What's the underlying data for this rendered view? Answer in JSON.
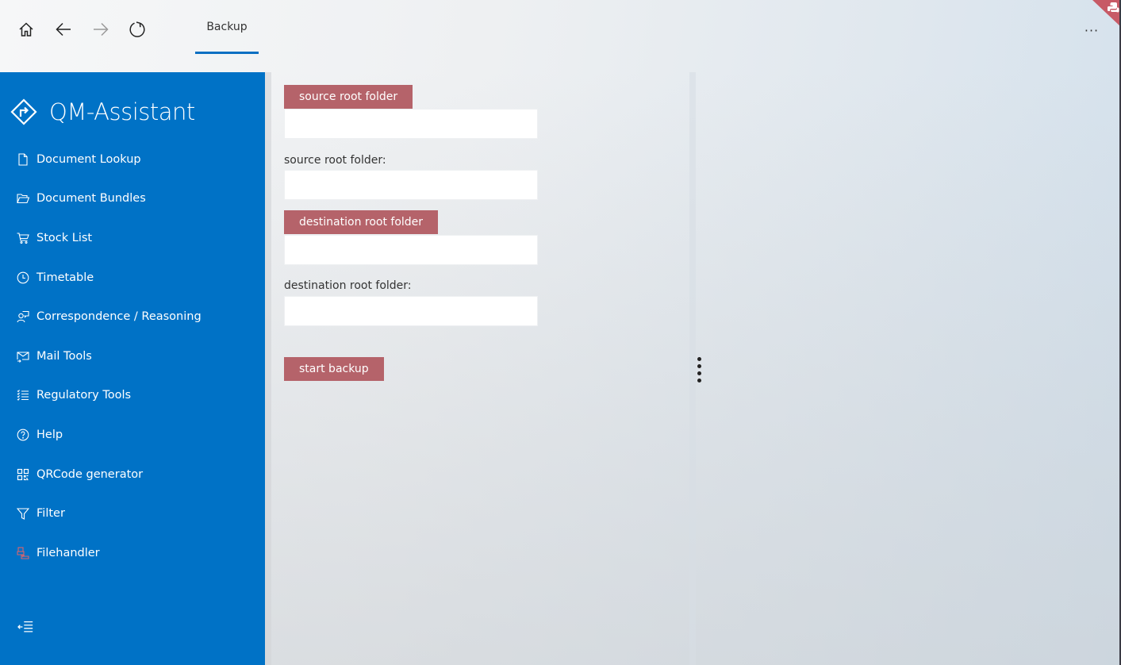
{
  "topbar": {
    "nav": [
      {
        "name": "home-icon",
        "label": "Home"
      },
      {
        "name": "back-arrow-icon",
        "label": "Back"
      },
      {
        "name": "forward-arrow-icon",
        "label": "Forward",
        "disabled": true
      },
      {
        "name": "refresh-icon",
        "label": "Refresh"
      }
    ],
    "active_tab": "Backup",
    "more_label": "···",
    "corner_badge_icon": "python-icon",
    "accent_color": "#0b6fc2"
  },
  "sidebar": {
    "app_title": "QM-Assistant",
    "logo_icon": "direction-sign-icon",
    "background_color": "#0072c6",
    "items": [
      {
        "label": "Document Lookup",
        "icon": "document-icon"
      },
      {
        "label": "Document Bundles",
        "icon": "folder-open-icon"
      },
      {
        "label": "Stock List",
        "icon": "shopping-cart-icon"
      },
      {
        "label": "Timetable",
        "icon": "clock-icon"
      },
      {
        "label": "Correspondence / Reasoning",
        "icon": "person-chat-icon"
      },
      {
        "label": "Mail Tools",
        "icon": "mail-forward-icon"
      },
      {
        "label": "Regulatory Tools",
        "icon": "checklist-icon"
      },
      {
        "label": "Help",
        "icon": "help-circle-icon"
      },
      {
        "label": "QRCode generator",
        "icon": "qr-code-icon"
      },
      {
        "label": "Filter",
        "icon": "filter-icon"
      },
      {
        "label": "Filehandler",
        "icon": "file-transfer-icon"
      }
    ],
    "collapse_icon": "collapse-menu-icon"
  },
  "form": {
    "source_button": "source root folder",
    "source_top_value": "",
    "source_label": "source root folder:",
    "source_value": "",
    "destination_button": "destination root folder",
    "destination_top_value": "",
    "destination_label": "destination root folder:",
    "destination_value": "",
    "start_button": "start backup",
    "button_color": "#b5636a"
  }
}
